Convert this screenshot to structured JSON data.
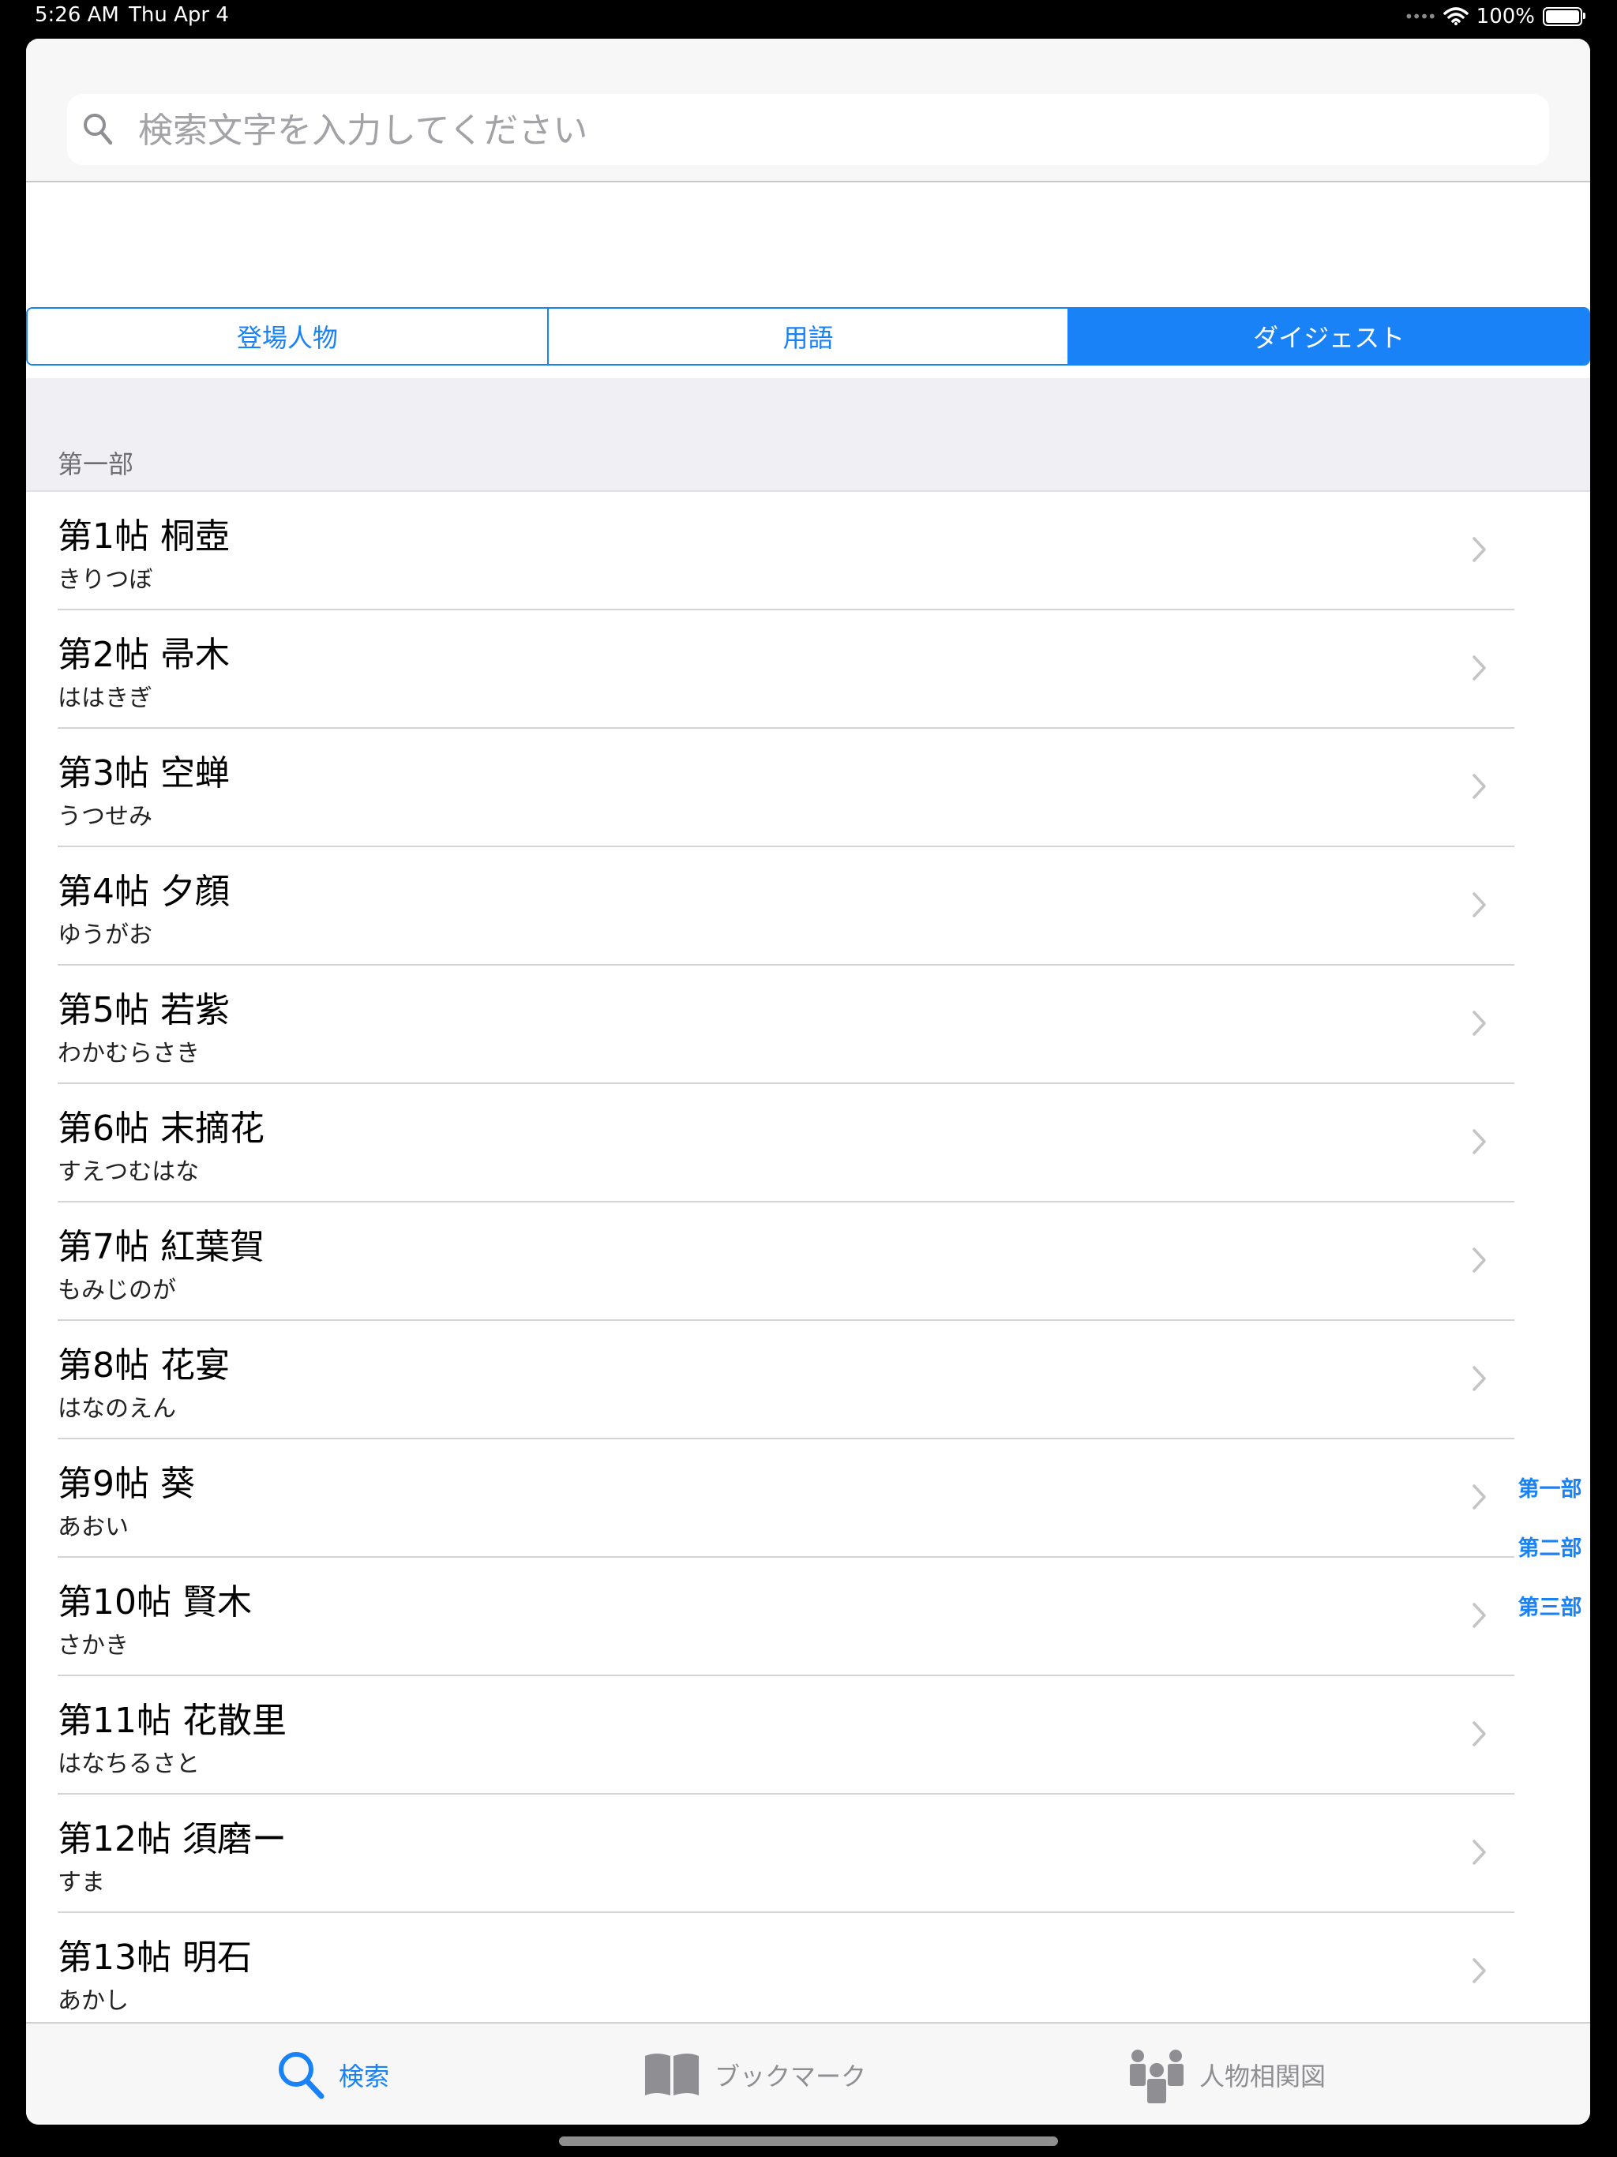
{
  "status": {
    "time": "5:26 AM",
    "date": "Thu Apr 4",
    "battery": "100%"
  },
  "search": {
    "placeholder": "検索文字を入力してください"
  },
  "segments": [
    {
      "label": "登場人物",
      "selected": false
    },
    {
      "label": "用語",
      "selected": false
    },
    {
      "label": "ダイジェスト",
      "selected": true
    }
  ],
  "section": {
    "title": "第一部"
  },
  "chapters": [
    {
      "title": "第1帖 桐壺",
      "reading": "きりつぼ"
    },
    {
      "title": "第2帖 帚木",
      "reading": "ははきぎ"
    },
    {
      "title": "第3帖 空蝉",
      "reading": "うつせみ"
    },
    {
      "title": "第4帖 夕顔",
      "reading": "ゆうがお"
    },
    {
      "title": "第5帖 若紫",
      "reading": "わかむらさき"
    },
    {
      "title": "第6帖 末摘花",
      "reading": "すえつむはな"
    },
    {
      "title": "第7帖 紅葉賀",
      "reading": "もみじのが"
    },
    {
      "title": "第8帖 花宴",
      "reading": "はなのえん"
    },
    {
      "title": "第9帖 葵",
      "reading": "あおい"
    },
    {
      "title": "第10帖 賢木",
      "reading": "さかき"
    },
    {
      "title": "第11帖 花散里",
      "reading": "はなちるさと"
    },
    {
      "title": "第12帖 須磨ー",
      "reading": "すま"
    },
    {
      "title": "第13帖 明石",
      "reading": "あかし"
    }
  ],
  "index": [
    "第一部",
    "第二部",
    "第三部"
  ],
  "tabs": [
    {
      "label": "検索",
      "icon": "search-icon",
      "active": true
    },
    {
      "label": "ブックマーク",
      "icon": "book-icon",
      "active": false
    },
    {
      "label": "人物相関図",
      "icon": "people-icon",
      "active": false
    }
  ],
  "colors": {
    "accent": "#1a82f7",
    "list_background": "#efeff4",
    "inactive_tab": "#8e8e93"
  }
}
